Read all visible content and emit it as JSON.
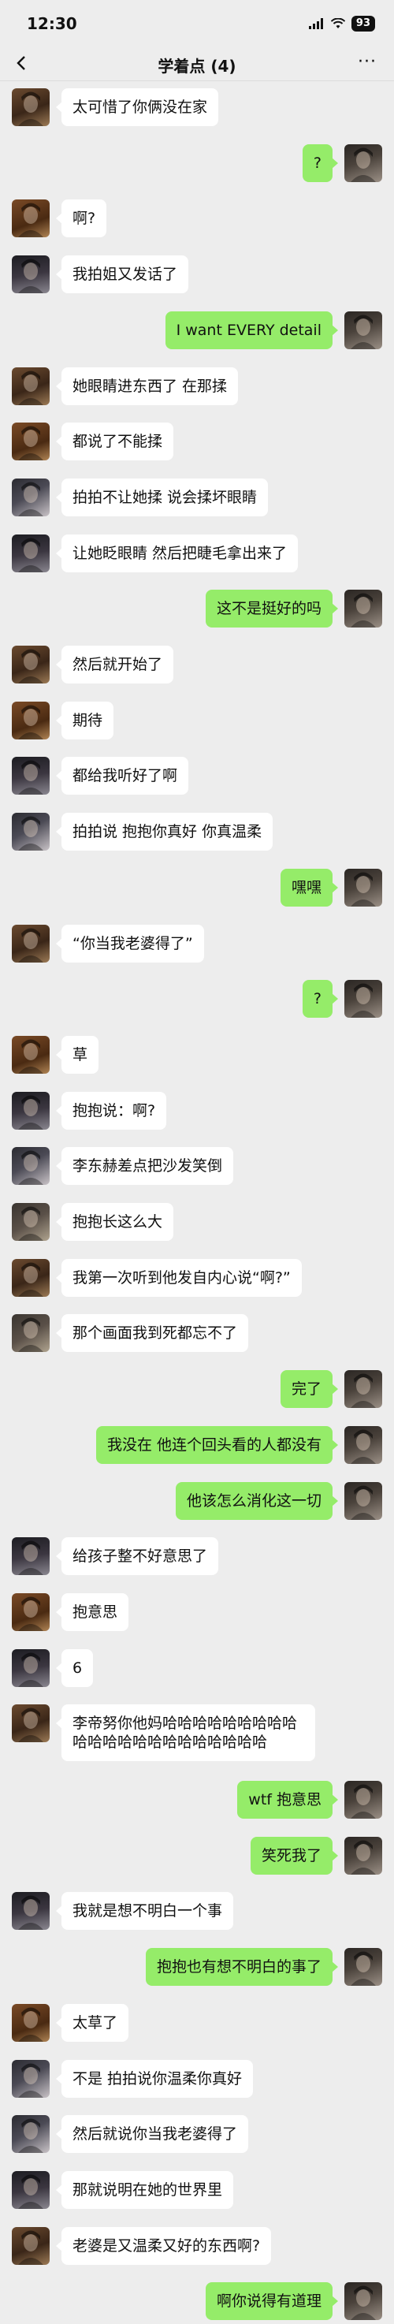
{
  "status": {
    "time": "12:30",
    "battery": "93"
  },
  "nav": {
    "title": "学着点 (4)",
    "more": "···"
  },
  "messages": [
    {
      "side": "left",
      "avatar": "a",
      "text": "太可惜了你俩没在家"
    },
    {
      "side": "right",
      "avatar": "me",
      "text": "?"
    },
    {
      "side": "left",
      "avatar": "d",
      "text": "啊?"
    },
    {
      "side": "left",
      "avatar": "c",
      "text": "我拍姐又发话了"
    },
    {
      "side": "right",
      "avatar": "me",
      "text": "I want EVERY detail"
    },
    {
      "side": "left",
      "avatar": "a",
      "text": "她眼睛进东西了 在那揉"
    },
    {
      "side": "left",
      "avatar": "d",
      "text": "都说了不能揉"
    },
    {
      "side": "left",
      "avatar": "b",
      "text": "拍拍不让她揉 说会揉坏眼睛"
    },
    {
      "side": "left",
      "avatar": "c",
      "text": "让她眨眼睛 然后把睫毛拿出来了"
    },
    {
      "side": "right",
      "avatar": "me",
      "text": "这不是挺好的吗"
    },
    {
      "side": "left",
      "avatar": "a",
      "text": "然后就开始了"
    },
    {
      "side": "left",
      "avatar": "d",
      "text": "期待"
    },
    {
      "side": "left",
      "avatar": "c",
      "text": "都给我听好了啊"
    },
    {
      "side": "left",
      "avatar": "b",
      "text": "拍拍说 抱抱你真好 你真温柔"
    },
    {
      "side": "right",
      "avatar": "me",
      "text": "嘿嘿"
    },
    {
      "side": "left",
      "avatar": "a",
      "text": "“你当我老婆得了”"
    },
    {
      "side": "right",
      "avatar": "me",
      "text": "?"
    },
    {
      "side": "left",
      "avatar": "d",
      "text": "草"
    },
    {
      "side": "left",
      "avatar": "c",
      "text": "抱抱说：啊?"
    },
    {
      "side": "left",
      "avatar": "b",
      "text": "李东赫差点把沙发笑倒"
    },
    {
      "side": "left",
      "avatar": "e",
      "text": "抱抱长这么大"
    },
    {
      "side": "left",
      "avatar": "a",
      "text": "我第一次听到他发自内心说“啊?”"
    },
    {
      "side": "left",
      "avatar": "e",
      "text": "那个画面我到死都忘不了"
    },
    {
      "side": "right",
      "avatar": "me",
      "text": "完了"
    },
    {
      "side": "right",
      "avatar": "me",
      "text": "我没在 他连个回头看的人都没有"
    },
    {
      "side": "right",
      "avatar": "me",
      "text": "他该怎么消化这一切"
    },
    {
      "side": "left",
      "avatar": "c",
      "text": "给孩子整不好意思了"
    },
    {
      "side": "left",
      "avatar": "d",
      "text": "抱意思"
    },
    {
      "side": "left",
      "avatar": "c",
      "text": "6"
    },
    {
      "side": "left",
      "avatar": "a",
      "text": "李帝努你他妈哈哈哈哈哈哈哈哈哈哈哈哈哈哈哈哈哈哈哈哈哈哈"
    },
    {
      "side": "right",
      "avatar": "me",
      "text": "wtf 抱意思"
    },
    {
      "side": "right",
      "avatar": "me",
      "text": "笑死我了"
    },
    {
      "side": "left",
      "avatar": "c",
      "text": "我就是想不明白一个事"
    },
    {
      "side": "right",
      "avatar": "me",
      "text": "抱抱也有想不明白的事了"
    },
    {
      "side": "left",
      "avatar": "d",
      "text": "太草了"
    },
    {
      "side": "left",
      "avatar": "b",
      "text": "不是 拍拍说你温柔你真好"
    },
    {
      "side": "left",
      "avatar": "b",
      "text": "然后就说你当我老婆得了"
    },
    {
      "side": "left",
      "avatar": "c",
      "text": "那就说明在她的世界里"
    },
    {
      "side": "left",
      "avatar": "a",
      "text": "老婆是又温柔又好的东西啊?"
    },
    {
      "side": "right",
      "avatar": "me",
      "text": "啊你说得有道理"
    }
  ]
}
